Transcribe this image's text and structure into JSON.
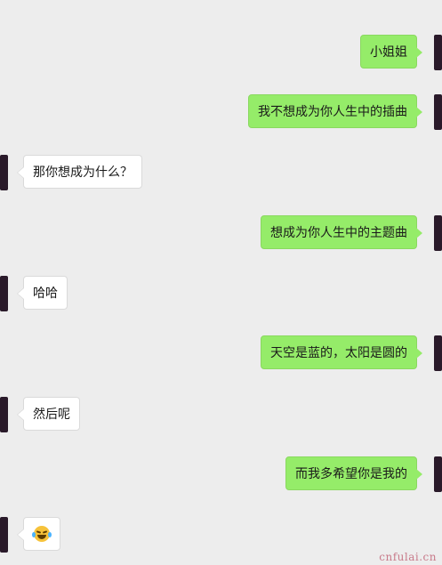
{
  "colors": {
    "background": "#ededed",
    "sent_bubble": "#95ec69",
    "received_bubble": "#ffffff",
    "avatar": "#2a1a2a"
  },
  "messages": [
    {
      "side": "right",
      "text": "小姐姐"
    },
    {
      "side": "right",
      "text": "我不想成为你人生中的插曲"
    },
    {
      "side": "left",
      "text": "那你想成为什么？"
    },
    {
      "side": "right",
      "text": "想成为你人生中的主题曲"
    },
    {
      "side": "left",
      "text": "哈哈"
    },
    {
      "side": "right",
      "text": "天空是蓝的，太阳是圆的"
    },
    {
      "side": "left",
      "text": "然后呢"
    },
    {
      "side": "right",
      "text": "而我多希望你是我的"
    },
    {
      "side": "left",
      "emoji": "face-with-tears-of-joy-icon"
    }
  ],
  "watermark": "cnfulai.cn"
}
